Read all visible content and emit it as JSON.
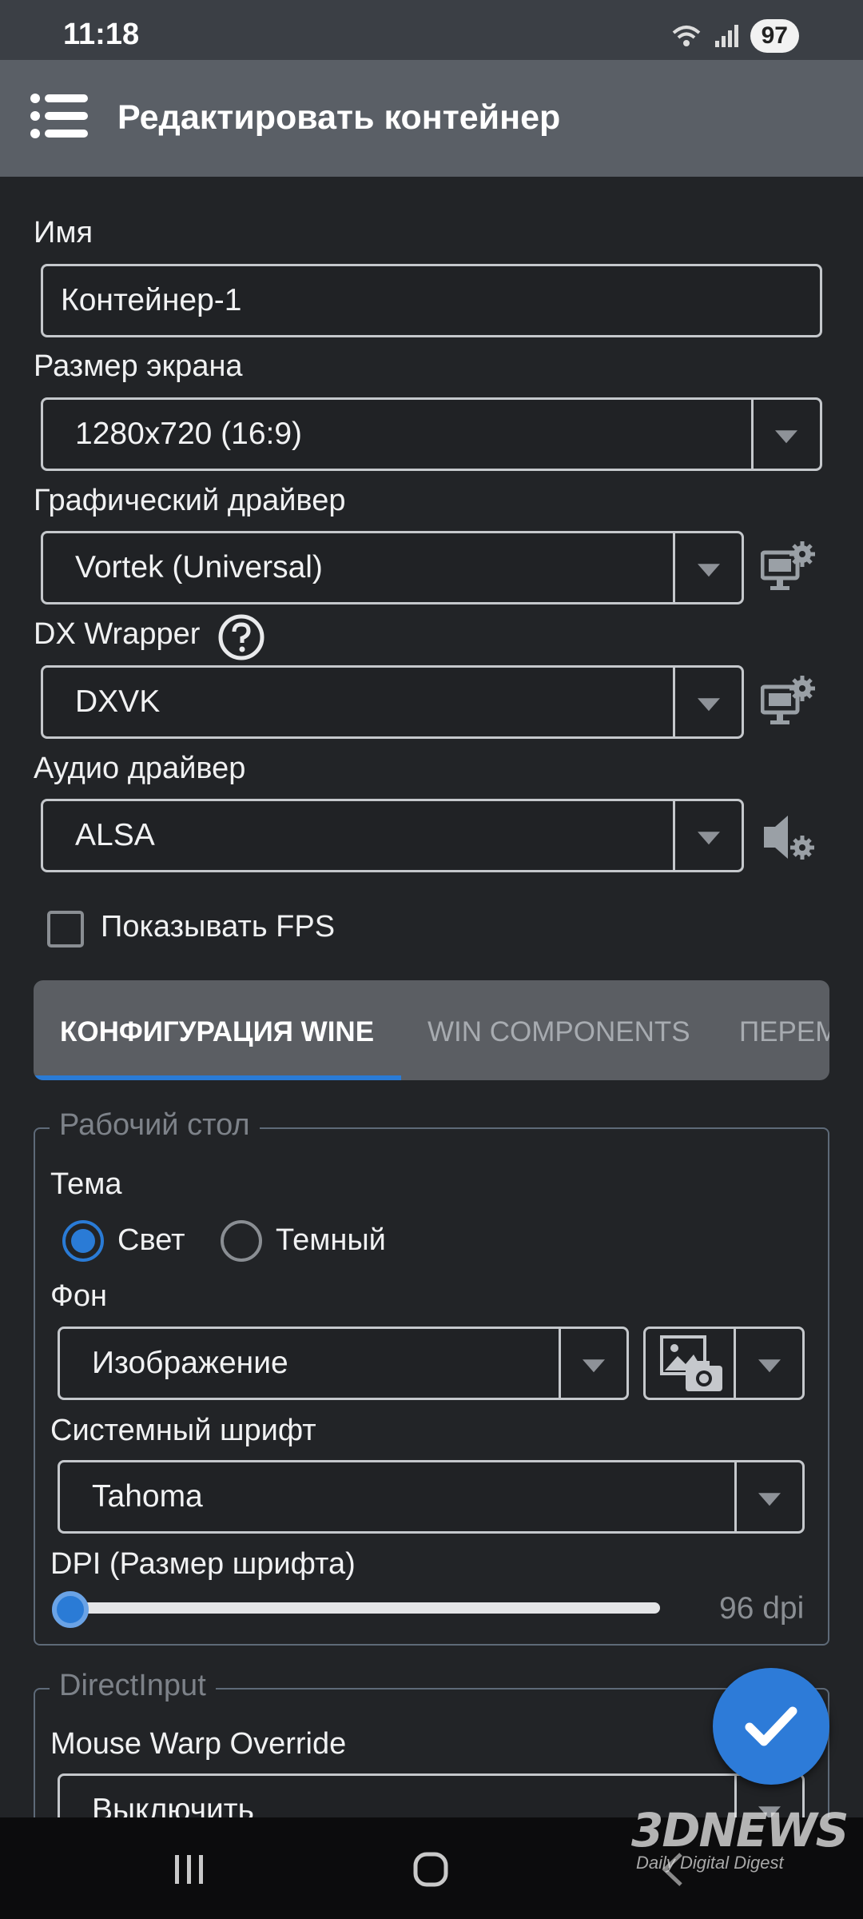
{
  "status_bar": {
    "time": "11:18",
    "battery": "97"
  },
  "header": {
    "title": "Редактировать контейнер"
  },
  "form": {
    "name_label": "Имя",
    "name_value": "Контейнер-1",
    "screen_size_label": "Размер экрана",
    "screen_size_value": "1280x720 (16:9)",
    "graphics_driver_label": "Графический драйвер",
    "graphics_driver_value": "Vortek (Universal)",
    "dx_wrapper_label": "DX Wrapper",
    "dx_wrapper_value": "DXVK",
    "audio_driver_label": "Аудио драйвер",
    "audio_driver_value": "ALSA",
    "show_fps_label": "Показывать FPS",
    "show_fps_checked": false
  },
  "tabs": [
    {
      "label": "КОНФИГУРАЦИЯ WINE",
      "active": true
    },
    {
      "label": "WIN COMPONENTS",
      "active": false
    },
    {
      "label": "ПЕРЕМ",
      "active": false
    }
  ],
  "desktop": {
    "legend": "Рабочий стол",
    "theme_label": "Тема",
    "theme_options": [
      "Свет",
      "Темный"
    ],
    "theme_selected": "Свет",
    "background_label": "Фон",
    "background_value": "Изображение",
    "system_font_label": "Системный шрифт",
    "system_font_value": "Tahoma",
    "dpi_label": "DPI (Размер шрифта)",
    "dpi_value_text": "96 dpi",
    "dpi_slider_fraction": 0.0
  },
  "direct_input": {
    "legend": "DirectInput",
    "mouse_warp_label": "Mouse Warp Override",
    "mouse_warp_value": "Выключить"
  },
  "watermark": {
    "brand": "3DNEWS",
    "tagline": "Daily Digital Digest"
  },
  "colors": {
    "accent": "#2a7bd6",
    "background": "#222427",
    "app_bar": "#5a5f66"
  }
}
